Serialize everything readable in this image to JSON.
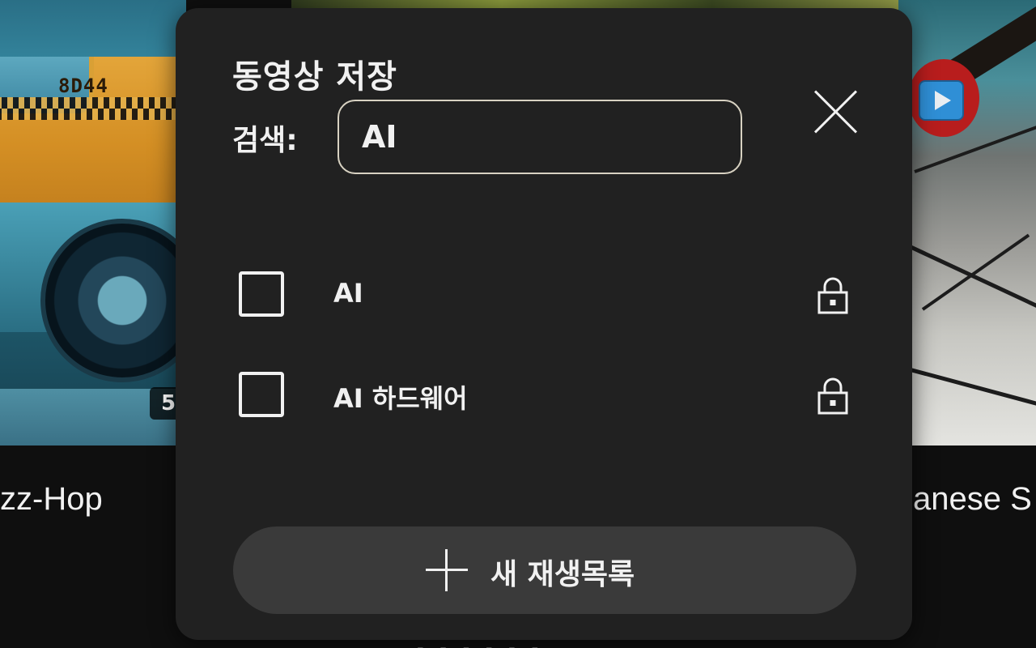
{
  "background": {
    "left_card": {
      "plate_text": "8D44",
      "duration_badge": "5",
      "title_fragment": "zz-Hop"
    },
    "right_card": {
      "title_fragment": "anese S"
    },
    "bottom_faint_text": "- - - - - -"
  },
  "dialog": {
    "title": "동영상 저장",
    "search": {
      "label": "검색:",
      "value": "AI"
    },
    "playlists": [
      {
        "label": "AI",
        "checked": false,
        "privacy_icon": "lock-icon"
      },
      {
        "label": "AI 하드웨어",
        "checked": false,
        "privacy_icon": "lock-icon"
      }
    ],
    "new_playlist_label": "새 재생목록"
  },
  "colors": {
    "dialog_bg": "#212121",
    "button_bg": "#3a3a3a",
    "text": "#f1f1f1",
    "search_border": "#d8d2c2"
  }
}
